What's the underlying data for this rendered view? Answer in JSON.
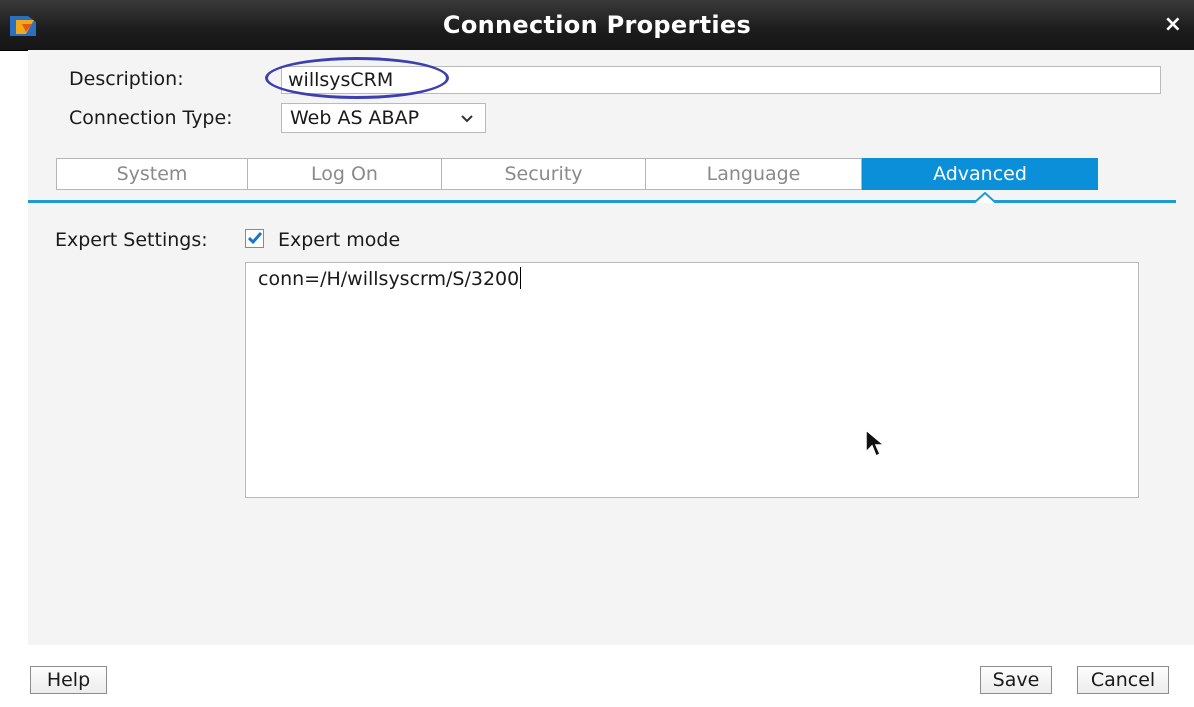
{
  "window": {
    "title": "Connection Properties",
    "close_glyph": "×",
    "app_icon": "sap-logon-icon"
  },
  "form": {
    "description_label": "Description:",
    "description_value": "willsysCRM",
    "connection_type_label": "Connection Type:",
    "connection_type_value": "Web AS ABAP"
  },
  "tabs": [
    {
      "label": "System",
      "active": false
    },
    {
      "label": "Log On",
      "active": false
    },
    {
      "label": "Security",
      "active": false
    },
    {
      "label": "Language",
      "active": false
    },
    {
      "label": "Advanced",
      "active": true
    }
  ],
  "advanced": {
    "expert_settings_label": "Expert Settings:",
    "expert_mode_label": "Expert mode",
    "expert_mode_checked": true,
    "connection_string": "conn=/H/willsyscrm/S/3200"
  },
  "buttons": {
    "help": "Help",
    "save": "Save",
    "cancel": "Cancel"
  },
  "colors": {
    "accent": "#0a8fd8",
    "annotation_oval": "#3b3fb0"
  }
}
